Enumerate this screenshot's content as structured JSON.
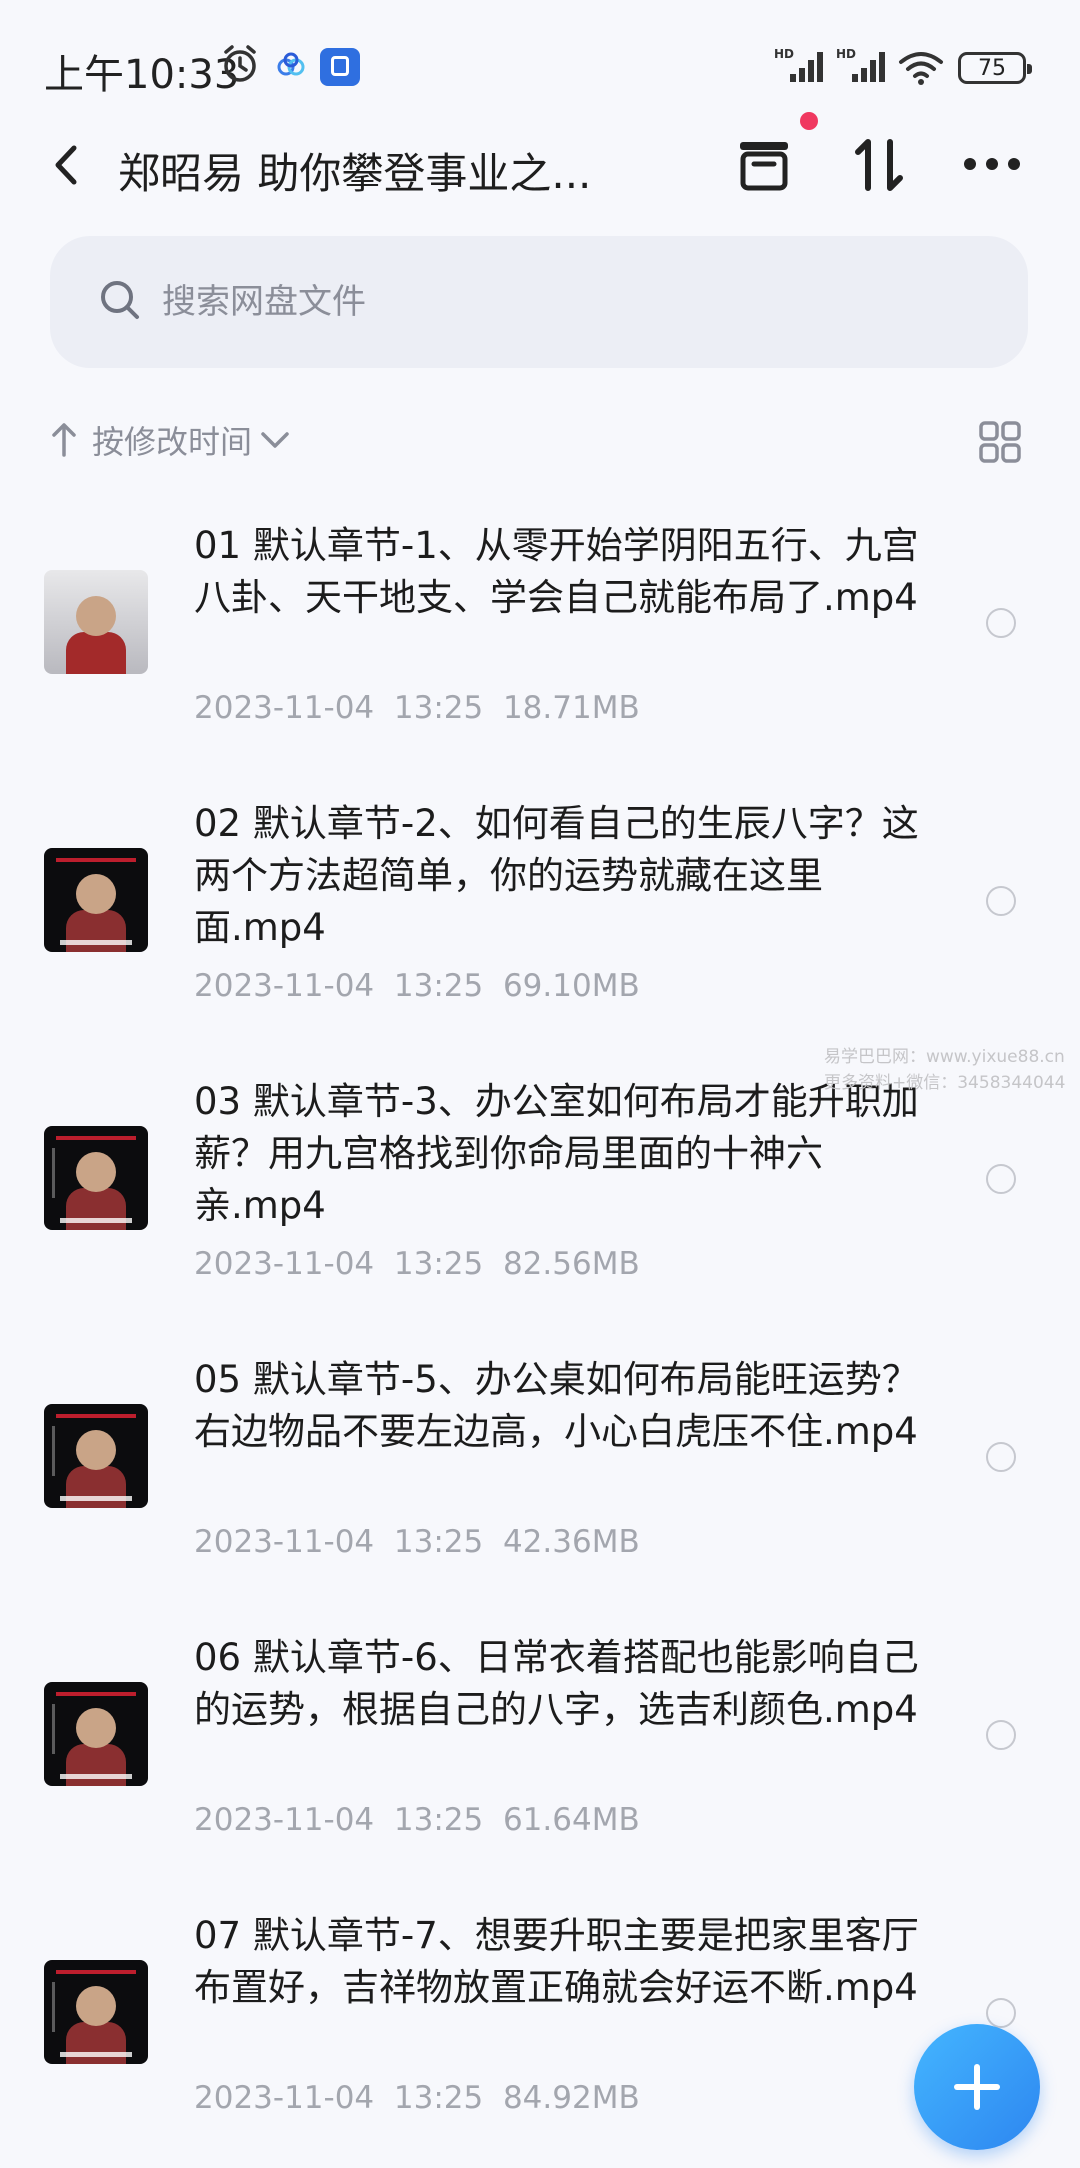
{
  "status_bar": {
    "time": "上午10:33",
    "signal1_label": "HD",
    "signal2_label": "HD",
    "battery": "75"
  },
  "header": {
    "title": "郑昭易 助你攀登事业之..."
  },
  "search": {
    "placeholder": "搜索网盘文件"
  },
  "sort": {
    "label": "按修改时间"
  },
  "files": [
    {
      "name": "01 默认章节-1、从零开始学阴阳五行、九宫八卦、天干地支、学会自己就能布局了.mp4",
      "date": "2023-11-04",
      "time": "13:25",
      "size": "18.71MB",
      "thumb_style": "light"
    },
    {
      "name": "02 默认章节-2、如何看自己的生辰八字？这两个方法超简单，你的运势就藏在这里面.mp4",
      "date": "2023-11-04",
      "time": "13:25",
      "size": "69.10MB",
      "thumb_style": "dark"
    },
    {
      "name": "03 默认章节-3、办公室如何布局才能升职加薪？用九宫格找到你命局里面的十神六亲.mp4",
      "date": "2023-11-04",
      "time": "13:25",
      "size": "82.56MB",
      "thumb_style": "dark"
    },
    {
      "name": "05 默认章节-5、办公桌如何布局能旺运势？右边物品不要左边高，小心白虎压不住.mp4",
      "date": "2023-11-04",
      "time": "13:25",
      "size": "42.36MB",
      "thumb_style": "dark"
    },
    {
      "name": "06 默认章节-6、日常衣着搭配也能影响自己的运势，根据自己的八字，选吉利颜色.mp4",
      "date": "2023-11-04",
      "time": "13:25",
      "size": "61.64MB",
      "thumb_style": "dark"
    },
    {
      "name": "07 默认章节-7、想要升职主要是把家里客厅布置好，吉祥物放置正确就会好运不断.mp4",
      "date": "2023-11-04",
      "time": "13:25",
      "size": "84.92MB",
      "thumb_style": "dark"
    }
  ],
  "watermark": "易学巴巴网：www.yixue88.cn\n更多资料+微信：3458344044",
  "colors": {
    "accent": "#2d86f0",
    "notification_dot": "#f03860",
    "meta_text": "#a3a6ae"
  }
}
